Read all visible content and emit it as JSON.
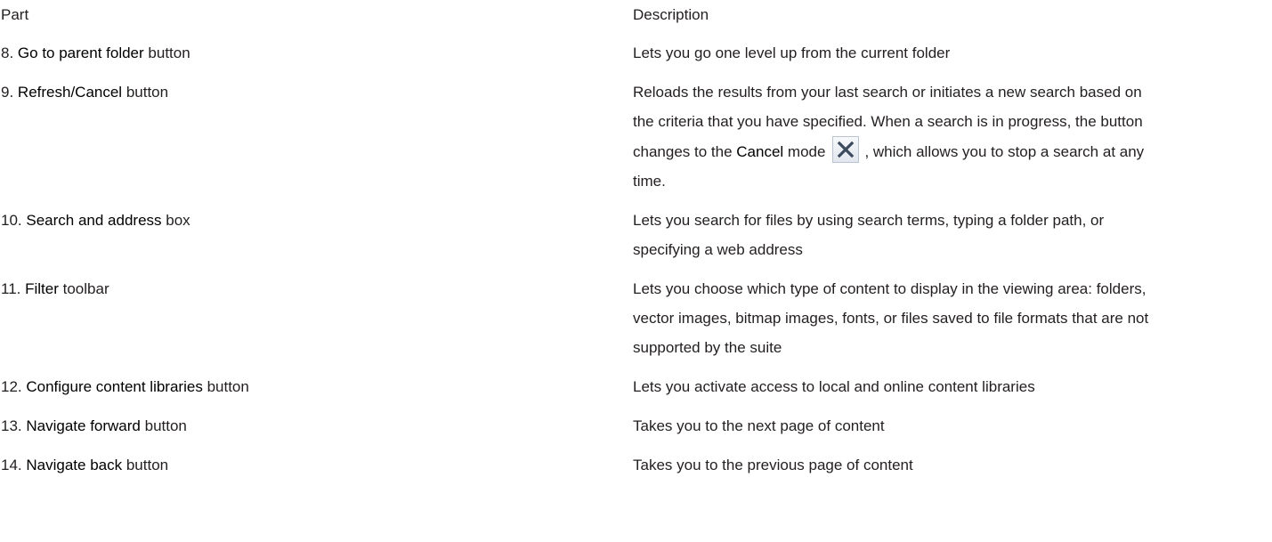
{
  "header": {
    "part": "Part",
    "description": "Description"
  },
  "rows": [
    {
      "num": "8.",
      "name": "Go to parent folder",
      "suffix": "button",
      "description": "Lets you go one level up from the current folder"
    },
    {
      "num": "9.",
      "name": "Refresh/Cancel",
      "suffix": "button",
      "description_a": "Reloads the results from your last search or initiates a new search based on the criteria that you have specified. When a search is in progress, the button changes to the",
      "description_b": "Cancel",
      "description_c": "mode",
      "description_d": ", which allows you to stop a search at any time.",
      "icon": "cancel-x-icon"
    },
    {
      "num": "10.",
      "name": "Search and address",
      "suffix": "box",
      "description": "Lets you search for files by using search terms, typing a folder path, or specifying a web address"
    },
    {
      "num": "11.",
      "name": "Filter",
      "suffix": "toolbar",
      "description": "Lets you choose which type of content to display in the viewing area: folders, vector images, bitmap images, fonts, or files saved to file formats that are not supported by the suite"
    },
    {
      "num": "12.",
      "name": "Configure content libraries",
      "suffix": "button",
      "description": "Lets you activate access to local and online content libraries"
    },
    {
      "num": "13.",
      "name": "Navigate forward",
      "suffix": "button",
      "description": "Takes you to the next page of content"
    },
    {
      "num": "14.",
      "name": "Navigate back",
      "suffix": "button",
      "description": "Takes you to the previous page of content"
    }
  ]
}
